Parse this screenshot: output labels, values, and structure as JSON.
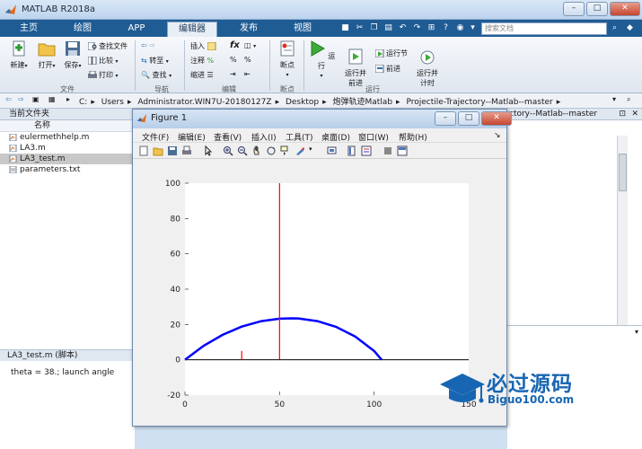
{
  "app": {
    "title": "MATLAB R2018a",
    "search_placeholder": "搜索文档"
  },
  "tabs": [
    "主页",
    "绘图",
    "APP",
    "编辑器",
    "发布",
    "视图"
  ],
  "active_tab": "编辑器",
  "ribbon": {
    "file_group": {
      "label": "文件",
      "new": "新建",
      "open": "打开",
      "save": "保存",
      "find_files": "查找文件",
      "compare": "比较",
      "print": "打印"
    },
    "nav_group": {
      "label": "导航",
      "goto": "转至",
      "find": "查找"
    },
    "edit_group": {
      "label": "编辑",
      "insert": "插入",
      "comment": "注释",
      "indent": "缩进",
      "fx": "fx"
    },
    "breakpoint_group": {
      "label": "断点",
      "breakpoints": "断点"
    },
    "run_group": {
      "label": "运行",
      "run": "运行",
      "run_advance": "运行并\n前进",
      "run_section": "运行节",
      "advance": "前进",
      "run_time": "运行并\n计时"
    }
  },
  "address": {
    "path": [
      "C:",
      "Users",
      "Administrator.WIN7U-20180127Z",
      "Desktop",
      "炮弹轨迹Matlab",
      "Projectile-Trajectory--Matlab--master"
    ],
    "right_fragment": "ctory--Matlab--master"
  },
  "current_folder": {
    "title": "当前文件夹",
    "column": "名称",
    "files": [
      {
        "name": "eulermethhelp.m",
        "selected": false
      },
      {
        "name": "LA3.m",
        "selected": false
      },
      {
        "name": "LA3_test.m",
        "selected": true
      },
      {
        "name": "parameters.txt",
        "selected": false
      }
    ]
  },
  "details": {
    "title": "LA3_test.m  (脚本)",
    "content": "theta = 38.; launch angle"
  },
  "figure": {
    "title": "Figure 1",
    "menu": [
      "文件(F)",
      "编辑(E)",
      "查看(V)",
      "插入(I)",
      "工具(T)",
      "桌面(D)",
      "窗口(W)",
      "帮助(H)"
    ]
  },
  "chart_data": {
    "type": "line",
    "xlim": [
      0,
      150
    ],
    "ylim": [
      -20,
      100
    ],
    "xticks": [
      0,
      50,
      100,
      150
    ],
    "yticks": [
      -20,
      0,
      20,
      40,
      60,
      80,
      100
    ],
    "grid": false,
    "series": [
      {
        "color": "#0000ff",
        "x": [
          0,
          10,
          20,
          30,
          40,
          50,
          56,
          60,
          70,
          80,
          90,
          100,
          104
        ],
        "y": [
          0,
          8.0,
          14.2,
          18.8,
          21.8,
          23.3,
          23.5,
          23.4,
          21.9,
          18.6,
          13.2,
          5.0,
          0
        ]
      },
      {
        "color": "#ff0000",
        "x": [
          50,
          50
        ],
        "y": [
          0,
          100
        ]
      },
      {
        "color": "#ff0000",
        "x": [
          30,
          30
        ],
        "y": [
          0,
          5
        ]
      }
    ]
  },
  "watermark": {
    "main": "必过源码",
    "sub": "Biguo100.com"
  }
}
